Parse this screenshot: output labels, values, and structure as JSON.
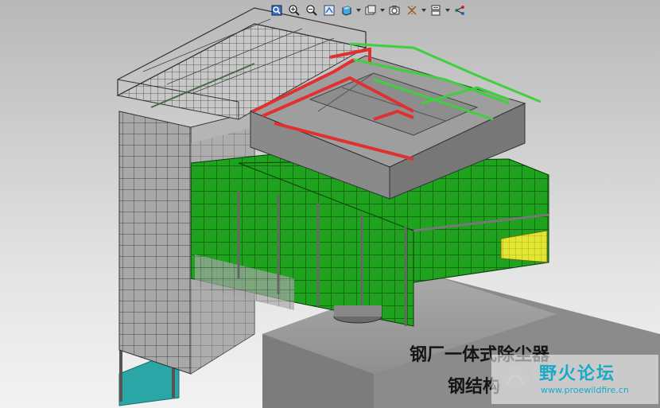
{
  "toolbar": {
    "icons": [
      "zoom-fit-icon",
      "zoom-in-icon",
      "zoom-out-icon",
      "refit-icon",
      "display-style-icon",
      "saved-views-icon",
      "spin-center-icon",
      "datum-display-icon",
      "annotation-display-icon",
      "model-tree-icon"
    ]
  },
  "caption": {
    "line1": "钢厂一体式除尘器",
    "line2": "钢结构"
  },
  "watermark": {
    "title": "野火论坛",
    "url": "www.proewildfire.cn"
  },
  "colors": {
    "panel_green": "#1a9e1a",
    "pipe_red": "#e03030",
    "pipe_green": "#44cc44",
    "hopper_yellow": "#e6e83a",
    "floor_teal": "#2aa6a6",
    "steel_gray": "#8c8c8c",
    "concrete": "#9a9a9a"
  }
}
